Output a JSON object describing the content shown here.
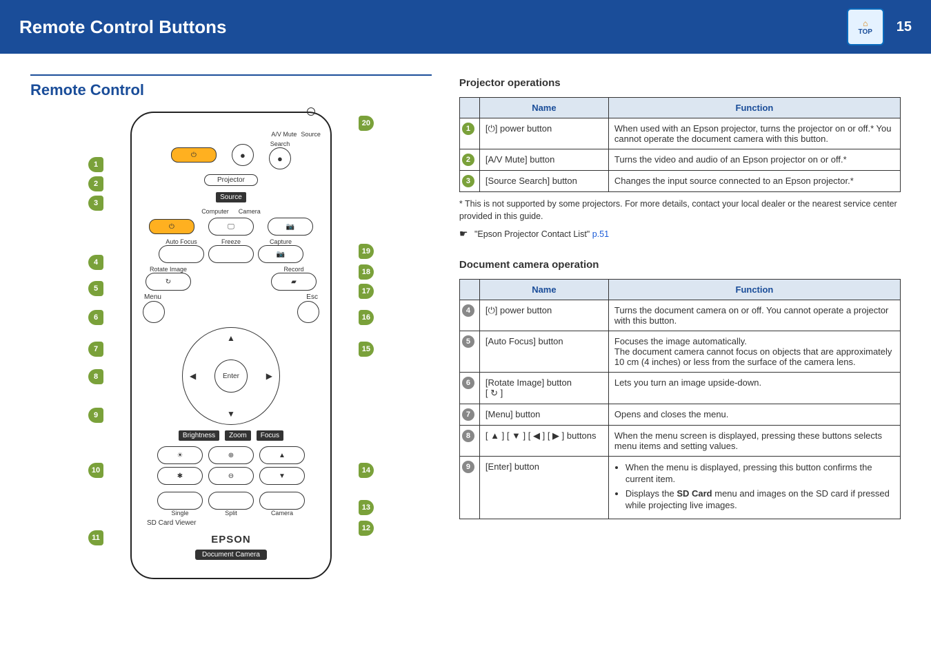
{
  "header": {
    "title": "Remote Control Buttons",
    "badge_top": "TOP",
    "page_number": "15"
  },
  "left": {
    "section_title": "Remote Control",
    "remote": {
      "top_labels": {
        "avmute": "A/V Mute",
        "source_search1": "Source",
        "source_search2": "Search"
      },
      "group_projector": "Projector",
      "source_label": "Source",
      "computer": "Computer",
      "camera": "Camera",
      "autofocus": "Auto Focus",
      "freeze": "Freeze",
      "capture": "Capture",
      "rotate": "Rotate Image",
      "record": "Record",
      "menu": "Menu",
      "esc": "Esc",
      "enter": "Enter",
      "brightness": "Brightness",
      "zoom": "Zoom",
      "focus": "Focus",
      "single": "Single",
      "split": "Split",
      "camera_btn": "Camera",
      "sdviewer": "SD Card Viewer",
      "brand": "EPSON",
      "brand_sub": "Document Camera"
    }
  },
  "right": {
    "projector": {
      "title": "Projector operations",
      "cols": {
        "name": "Name",
        "func": "Function"
      },
      "rows": [
        {
          "n": "1",
          "name": "[⏻] power button",
          "func": "When used with an Epson projector, turns the projector on or off.* You cannot operate the document camera with this button."
        },
        {
          "n": "2",
          "name": "[A/V Mute] button",
          "func": "Turns the video and audio of an Epson projector on or off.*"
        },
        {
          "n": "3",
          "name": "[Source Search] button",
          "func": "Changes the input source connected to an Epson projector.*"
        }
      ],
      "footnote_star": "* This is not supported by some projectors. For more details, contact your local dealer or the nearest service center provided in this guide.",
      "footnote_link_pre": "\"Epson Projector Contact List\" ",
      "footnote_link": "p.51"
    },
    "doccam": {
      "title": "Document camera operation",
      "cols": {
        "name": "Name",
        "func": "Function"
      },
      "rows": [
        {
          "n": "4",
          "name": "[⏻] power button",
          "func": "Turns the document camera on or off. You cannot operate a projector with this button."
        },
        {
          "n": "5",
          "name": "[Auto Focus] button",
          "func": "Focuses the image automatically.\nThe document camera cannot focus on objects that are approximately 10 cm (4 inches) or less from the surface of the camera lens."
        },
        {
          "n": "6",
          "name": "[Rotate Image] button\n[ ↻ ]",
          "func": "Lets you turn an image upside-down."
        },
        {
          "n": "7",
          "name": "[Menu] button",
          "func": "Opens and closes the menu."
        },
        {
          "n": "8",
          "name": "[ ▲ ] [ ▼ ] [ ◀ ] [ ▶ ] buttons",
          "func": "When the menu screen is displayed, pressing these buttons selects menu items and setting values."
        },
        {
          "n": "9",
          "name": "[Enter] button",
          "func_bullets": [
            "When the menu is displayed, pressing this button confirms the current item.",
            "Displays the SD Card menu and images on the SD card if pressed while projecting live images."
          ]
        }
      ]
    }
  }
}
